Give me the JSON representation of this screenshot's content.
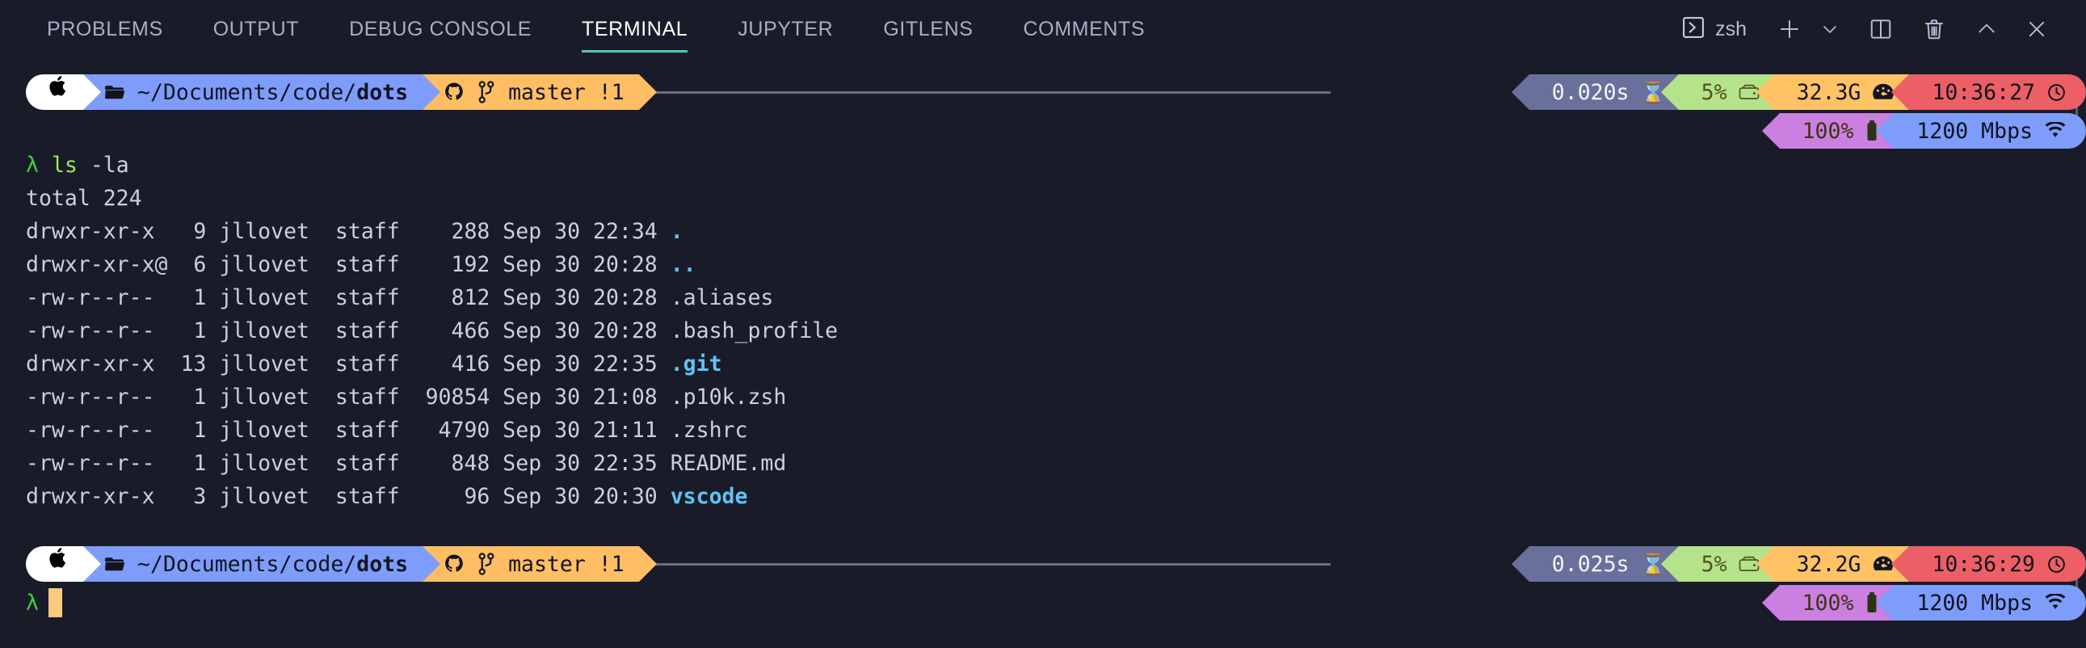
{
  "tabs": [
    {
      "label": "PROBLEMS",
      "active": false
    },
    {
      "label": "OUTPUT",
      "active": false
    },
    {
      "label": "DEBUG CONSOLE",
      "active": false
    },
    {
      "label": "TERMINAL",
      "active": true
    },
    {
      "label": "JUPYTER",
      "active": false
    },
    {
      "label": "GITLENS",
      "active": false
    },
    {
      "label": "COMMENTS",
      "active": false
    }
  ],
  "toolbar": {
    "shell_label": "zsh",
    "new_terminal_title": "New Terminal",
    "dropdown_title": "Launch Profile",
    "split_title": "Split Terminal",
    "kill_title": "Kill Terminal",
    "maximize_title": "Maximize Panel Size",
    "close_title": "Close Panel"
  },
  "colors": {
    "background": "#191c28",
    "accent_underline": "#4ec9b0",
    "tab_active_text": "#ffffff",
    "tab_inactive_text": "#a9adc7",
    "dir_segment": "#7e9cfa",
    "git_segment": "#ffbe63",
    "duration_segment": "#69709c",
    "disk_segment": "#b5e38a",
    "memory_segment": "#ffc265",
    "time_segment": "#ec5f66",
    "battery_segment": "#cb7fe0",
    "network_segment": "#7e9cfa",
    "cursor": "#ffc97f",
    "prompt_lambda": "#3dd13d",
    "directory_listing": "#61c3f2"
  },
  "prompts": [
    {
      "os_icon": "apple-icon",
      "folder_icon": "folder-icon",
      "path_prefix": "~/Documents/code/",
      "path_leaf": "dots",
      "git_host_icon": "github-icon",
      "git_branch_icon": "branch-icon",
      "git_text": "master !1",
      "duration": "0.020s",
      "duration_icon": "hourglass-icon",
      "disk": "5%",
      "disk_icon": "disk-icon",
      "memory": "32.3G",
      "memory_icon": "gauge-icon",
      "time": "10:36:27",
      "time_icon": "clock-icon",
      "battery": "100%",
      "battery_icon": "battery-icon",
      "network": "1200 Mbps",
      "network_icon": "wifi-icon"
    },
    {
      "os_icon": "apple-icon",
      "folder_icon": "folder-icon",
      "path_prefix": "~/Documents/code/",
      "path_leaf": "dots",
      "git_host_icon": "github-icon",
      "git_branch_icon": "branch-icon",
      "git_text": "master !1",
      "duration": "0.025s",
      "duration_icon": "hourglass-icon",
      "disk": "5%",
      "disk_icon": "disk-icon",
      "memory": "32.2G",
      "memory_icon": "gauge-icon",
      "time": "10:36:29",
      "time_icon": "clock-icon",
      "battery": "100%",
      "battery_icon": "battery-icon",
      "network": "1200 Mbps",
      "network_icon": "wifi-icon"
    }
  ],
  "terminal": {
    "lambda": "λ",
    "command_name": "ls",
    "command_args": "-la",
    "total_line": "total 224",
    "listing": [
      {
        "perms": "drwxr-xr-x",
        "links": "9",
        "owner": "jllovet",
        "group": "staff",
        "size": "288",
        "month": "Sep",
        "day": "30",
        "time": "22:34",
        "name": ".",
        "kind": "dir"
      },
      {
        "perms": "drwxr-xr-x@",
        "links": "6",
        "owner": "jllovet",
        "group": "staff",
        "size": "192",
        "month": "Sep",
        "day": "30",
        "time": "20:28",
        "name": "..",
        "kind": "dir"
      },
      {
        "perms": "-rw-r--r--",
        "links": "1",
        "owner": "jllovet",
        "group": "staff",
        "size": "812",
        "month": "Sep",
        "day": "30",
        "time": "20:28",
        "name": ".aliases",
        "kind": "file"
      },
      {
        "perms": "-rw-r--r--",
        "links": "1",
        "owner": "jllovet",
        "group": "staff",
        "size": "466",
        "month": "Sep",
        "day": "30",
        "time": "20:28",
        "name": ".bash_profile",
        "kind": "file"
      },
      {
        "perms": "drwxr-xr-x",
        "links": "13",
        "owner": "jllovet",
        "group": "staff",
        "size": "416",
        "month": "Sep",
        "day": "30",
        "time": "22:35",
        "name": ".git",
        "kind": "dir"
      },
      {
        "perms": "-rw-r--r--",
        "links": "1",
        "owner": "jllovet",
        "group": "staff",
        "size": "90854",
        "month": "Sep",
        "day": "30",
        "time": "21:08",
        "name": ".p10k.zsh",
        "kind": "file"
      },
      {
        "perms": "-rw-r--r--",
        "links": "1",
        "owner": "jllovet",
        "group": "staff",
        "size": "4790",
        "month": "Sep",
        "day": "30",
        "time": "21:11",
        "name": ".zshrc",
        "kind": "file"
      },
      {
        "perms": "-rw-r--r--",
        "links": "1",
        "owner": "jllovet",
        "group": "staff",
        "size": "848",
        "month": "Sep",
        "day": "30",
        "time": "22:35",
        "name": "README.md",
        "kind": "file"
      },
      {
        "perms": "drwxr-xr-x",
        "links": "3",
        "owner": "jllovet",
        "group": "staff",
        "size": "96",
        "month": "Sep",
        "day": "30",
        "time": "20:30",
        "name": "vscode",
        "kind": "dir"
      }
    ]
  }
}
